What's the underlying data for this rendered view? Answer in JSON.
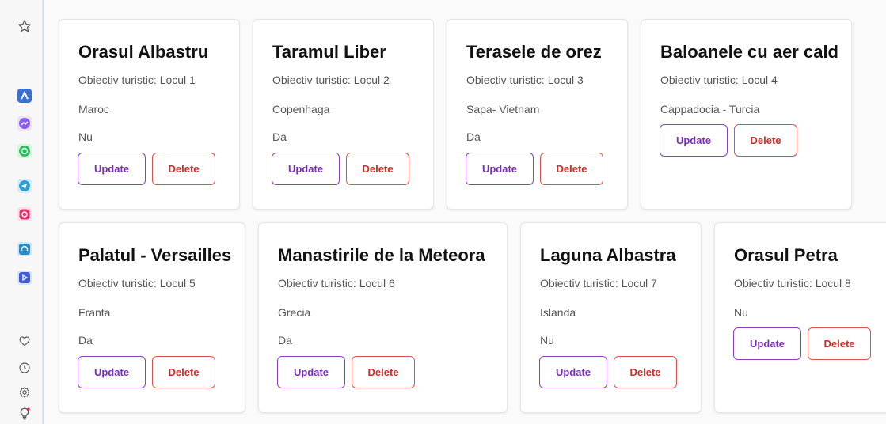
{
  "buttons": {
    "update": "Update",
    "delete": "Delete"
  },
  "colors": {
    "update_border": "#8a3fc7",
    "delete_border": "#d9534f",
    "sidebar_accent": "#dbe3f0"
  },
  "sidebar": {
    "top_icon": "star-icon",
    "apps": [
      "arc-icon",
      "messenger-icon",
      "whatsapp-icon",
      "telegram-icon",
      "instagram-icon",
      "headphones-icon",
      "player-icon"
    ],
    "bottom_icons": [
      "heart-icon",
      "clock-icon",
      "settings-icon",
      "bulb-icon"
    ]
  },
  "cards": [
    {
      "title": "Orasul Albastru",
      "subtitle": "Obiectiv turistic: Locul 1",
      "location": "Maroc",
      "answer": "Nu"
    },
    {
      "title": "Taramul Liber",
      "subtitle": "Obiectiv turistic: Locul 2",
      "location": "Copenhaga",
      "answer": "Da"
    },
    {
      "title": "Terasele de orez",
      "subtitle": "Obiectiv turistic: Locul 3",
      "location": "Sapa- Vietnam",
      "answer": "Da"
    },
    {
      "title": "Baloanele cu aer cald",
      "subtitle": "Obiectiv turistic: Locul 4",
      "location": "Cappadocia - Turcia",
      "answer": ""
    },
    {
      "title": "Palatul - Versailles",
      "subtitle": "Obiectiv turistic: Locul 5",
      "location": "Franta",
      "answer": "Da"
    },
    {
      "title": "Manastirile de la Meteora",
      "subtitle": "Obiectiv turistic: Locul 6",
      "location": "Grecia",
      "answer": "Da"
    },
    {
      "title": "Laguna Albastra",
      "subtitle": "Obiectiv turistic: Locul 7",
      "location": "Islanda",
      "answer": "Nu"
    },
    {
      "title": "Orasul Petra",
      "subtitle": "Obiectiv turistic: Locul 8",
      "location": "Nu",
      "answer": ""
    }
  ]
}
